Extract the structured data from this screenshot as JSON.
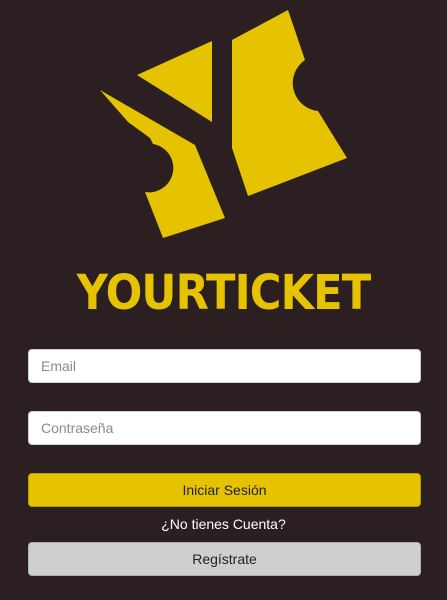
{
  "brand": {
    "name": "YOURTICKET",
    "logo_color": "#e6c300"
  },
  "form": {
    "email_placeholder": "Email",
    "password_placeholder": "Contraseña",
    "login_label": "Iniciar Sesión",
    "no_account_text": "¿No tienes Cuenta?",
    "register_label": "Regístrate"
  },
  "colors": {
    "background": "#2c1f22",
    "accent": "#e6c300",
    "secondary_button": "#cfcfcf"
  }
}
